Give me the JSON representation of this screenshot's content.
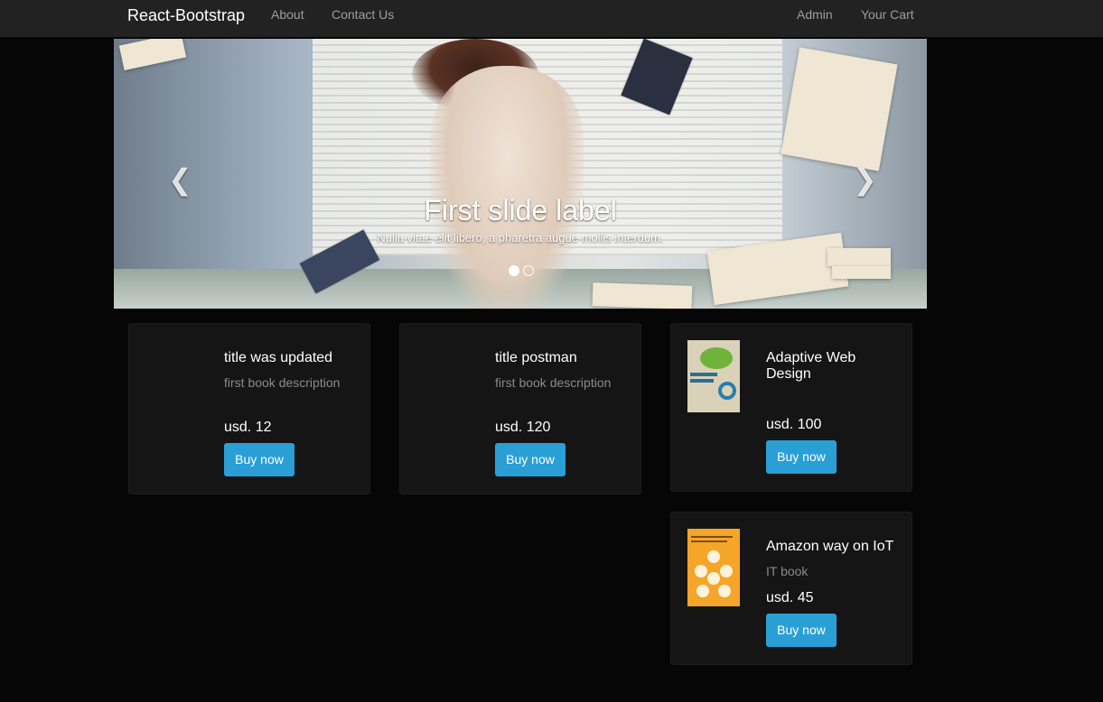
{
  "navbar": {
    "brand": "React-Bootstrap",
    "links": [
      "About",
      "Contact Us"
    ],
    "right_links": [
      "Admin",
      "Your Cart"
    ]
  },
  "carousel": {
    "prev_icon": "chevron-left-icon",
    "next_icon": "chevron-right-icon",
    "caption_title": "First slide label",
    "caption_text": "Nulla vitae elit libero, a pharetra augue mollis interdum.",
    "slide_count": 2,
    "active_slide": 1
  },
  "products": [
    {
      "title": "title was updated",
      "description": "first book description",
      "price": "usd. 12",
      "button": "Buy now"
    },
    {
      "title": "title postman",
      "description": "first book description",
      "price": "usd. 120",
      "button": "Buy now"
    },
    {
      "title": "Adaptive Web Design",
      "description": "",
      "price": "usd. 100",
      "button": "Buy now"
    },
    {
      "title": "Amazon way on IoT",
      "description": "IT book",
      "price": "usd. 45",
      "button": "Buy now"
    }
  ],
  "colors": {
    "navbar_bg": "#222222",
    "page_bg": "#060606",
    "card_bg": "#151515",
    "button_bg": "#2a9fd6",
    "nav_link": "#9d9d9d",
    "desc_text": "#8a8a8a"
  }
}
